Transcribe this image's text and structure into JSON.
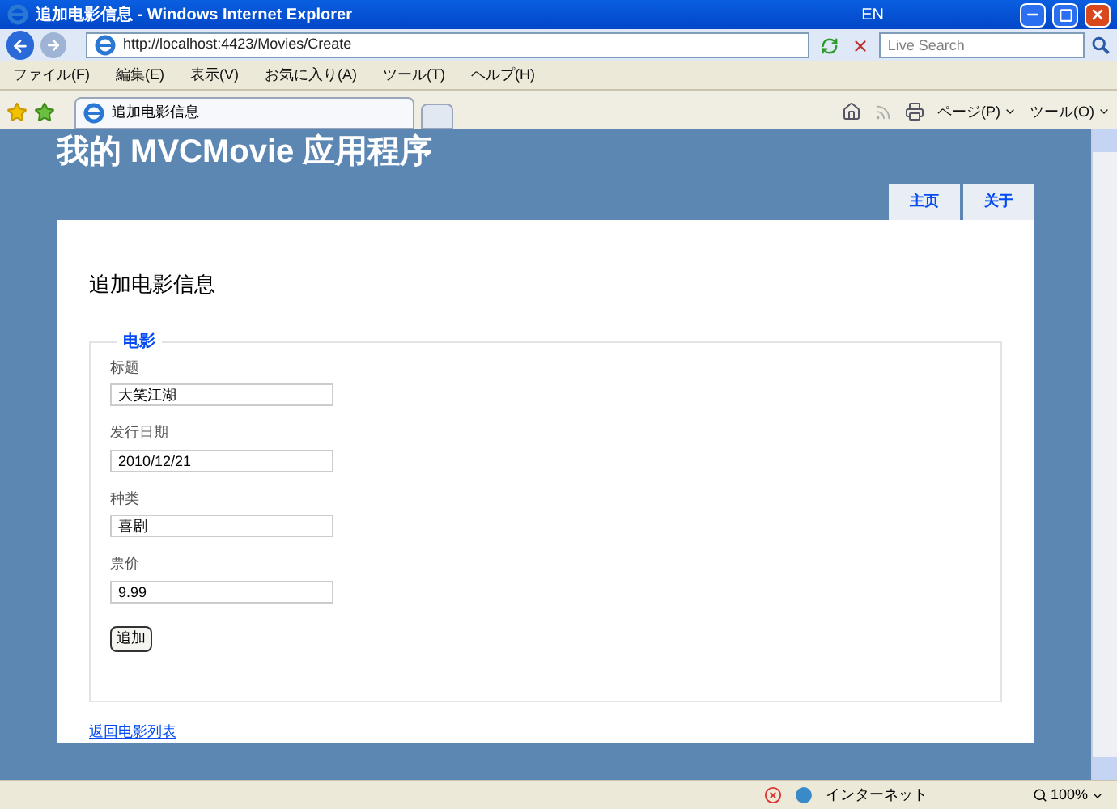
{
  "window": {
    "title": "追加电影信息 - Windows Internet Explorer",
    "language": "EN"
  },
  "address_bar": {
    "url": "http://localhost:4423/Movies/Create",
    "search_placeholder": "Live Search"
  },
  "menu": [
    "ファイル(F)",
    "編集(E)",
    "表示(V)",
    "お気に入り(A)",
    "ツール(T)",
    "ヘルプ(H)"
  ],
  "tabs": [
    {
      "label": "追加电影信息",
      "selected": true
    }
  ],
  "toolbar": [
    "ページ(P)",
    "ツール(O)"
  ],
  "page": {
    "site_title": "我的 MVCMovie 应用程序",
    "nav": [
      {
        "label": "主页"
      },
      {
        "label": "关于"
      }
    ],
    "heading": "追加电影信息",
    "legend": "电影",
    "fields": [
      {
        "label": "标题",
        "value": "大笑江湖"
      },
      {
        "label": "发行日期",
        "value": "2010/12/21"
      },
      {
        "label": "种类",
        "value": "喜剧"
      },
      {
        "label": "票价",
        "value": "9.99"
      }
    ],
    "submit": "追加",
    "back_link": "返回电影列表"
  },
  "status_bar": {
    "zone": "インターネット",
    "zoom": "100%"
  }
}
